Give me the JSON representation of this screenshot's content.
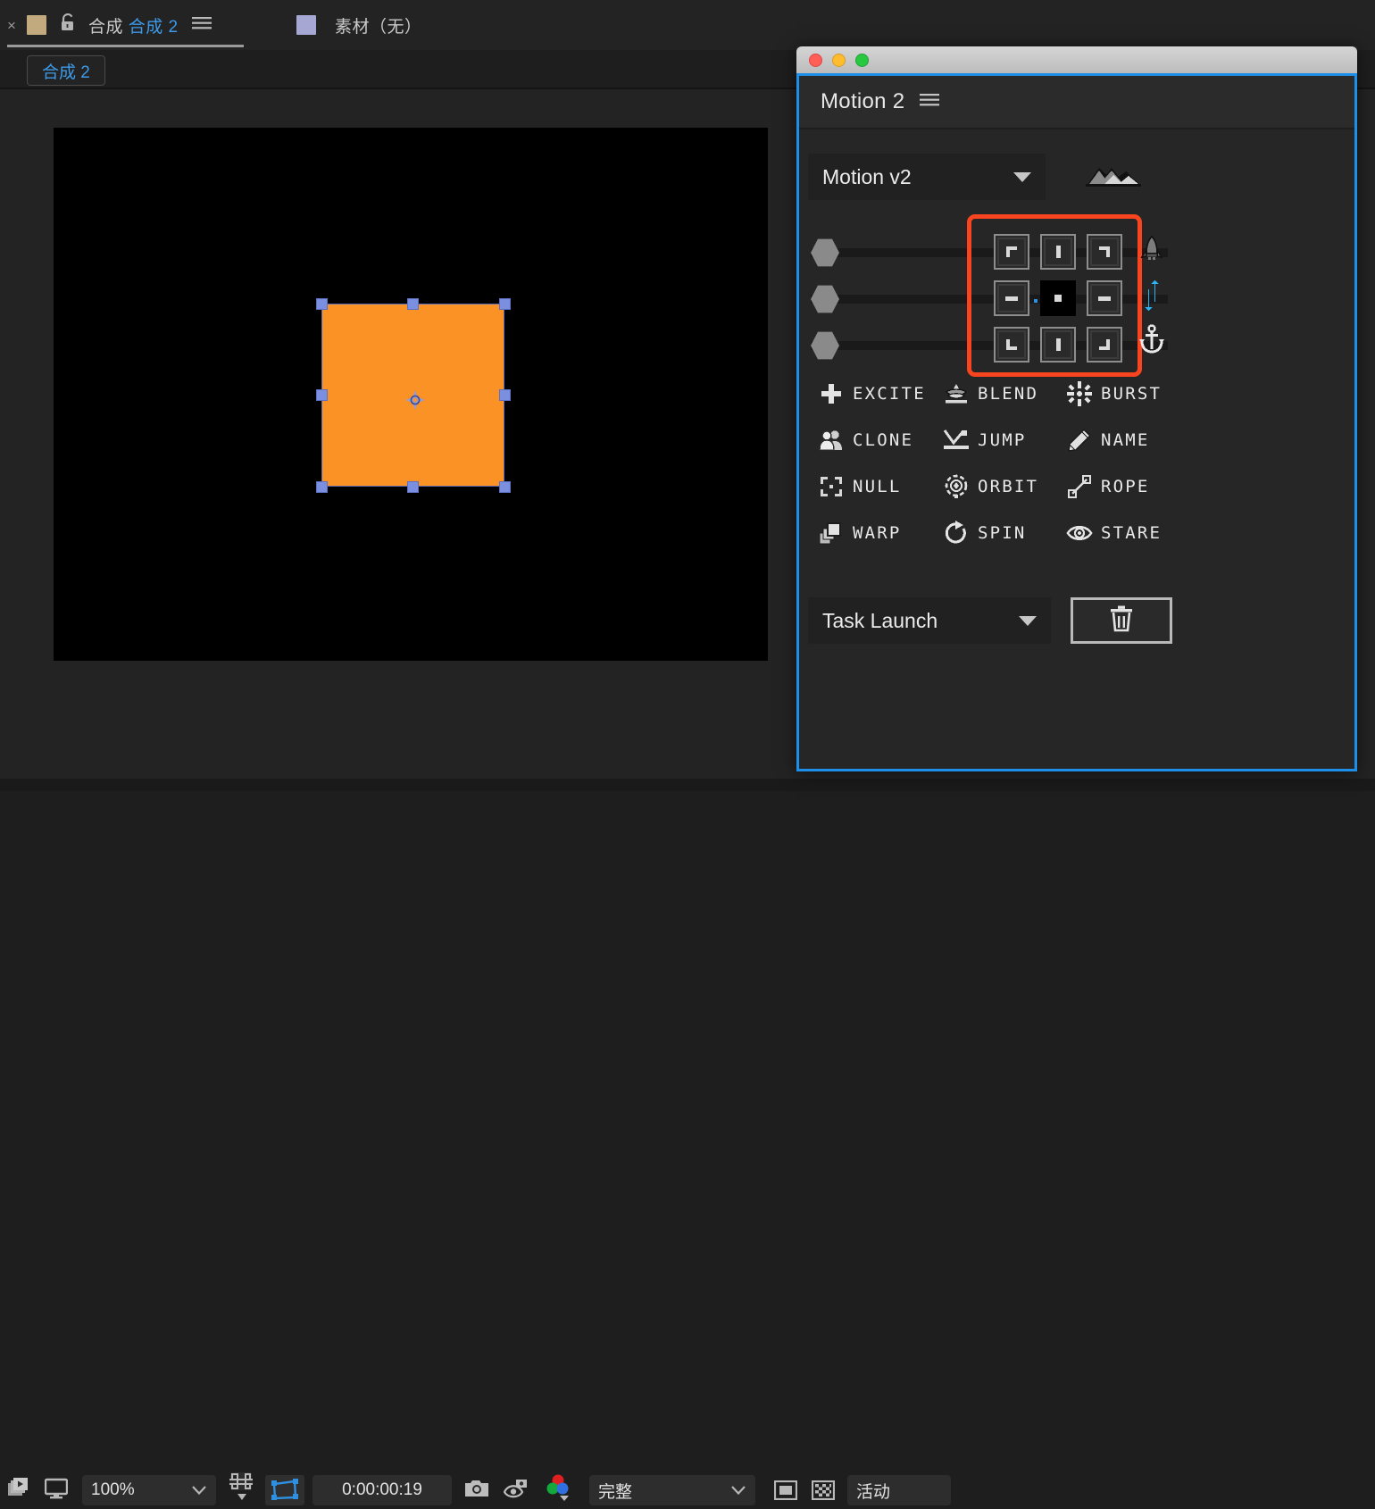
{
  "app": {
    "tabs": [
      {
        "close_label": "×",
        "swatch": "composition-swatch",
        "lock": "lock-icon",
        "label_prefix": "合成",
        "label_highlight": "合成 2",
        "menu": "panel-menu-icon"
      },
      {
        "swatch": "footage-swatch",
        "label": "素材（无）"
      }
    ],
    "comp_chip": "合成 2",
    "bottom_bar": {
      "zoom": "100%",
      "timecode": "0:00:00:19",
      "quality": "完整",
      "region_label": "活动",
      "icons": [
        "take-snapshot-stack-icon",
        "monitor-icon",
        "zoom-dropdown-caret",
        "grid-guides-icon",
        "region-of-interest-icon",
        "snapshot-camera-icon",
        "show-snapshot-icon",
        "channel-rgb-icon",
        "quality-dropdown-caret",
        "transparency-grid-icon",
        "toggle-alpha-icon"
      ]
    }
  },
  "motion_panel": {
    "window_controls": [
      "close-lamp",
      "minimize-lamp",
      "zoom-lamp"
    ],
    "title": "Motion 2",
    "menu_icon": "panel-menu-icon",
    "preset": {
      "value": "Motion v2",
      "caret": "chevron-down-icon",
      "decoration": "mountains-icon"
    },
    "sliders": [
      {
        "name": "slider-1",
        "value": 0
      },
      {
        "name": "slider-2",
        "value": 0
      },
      {
        "name": "slider-3",
        "value": 0
      }
    ],
    "anchor_grid": {
      "highlight_color": "#f9451f",
      "cells": [
        {
          "name": "anchor-top-left",
          "glyph": "corner-top-left",
          "selected": false
        },
        {
          "name": "anchor-top-center",
          "glyph": "bar-vertical",
          "selected": false
        },
        {
          "name": "anchor-top-right",
          "glyph": "corner-top-right",
          "selected": false
        },
        {
          "name": "anchor-middle-left",
          "glyph": "bar-horizontal",
          "selected": false
        },
        {
          "name": "anchor-center",
          "glyph": "dot-square",
          "selected": true
        },
        {
          "name": "anchor-middle-right",
          "glyph": "bar-horizontal",
          "selected": false
        },
        {
          "name": "anchor-bottom-left",
          "glyph": "corner-bottom-left",
          "selected": false
        },
        {
          "name": "anchor-bottom-center",
          "glyph": "bar-vertical",
          "selected": false
        },
        {
          "name": "anchor-bottom-right",
          "glyph": "corner-bottom-right",
          "selected": false
        }
      ]
    },
    "side_icons": [
      "rocket-icon",
      "vertical-arrows-icon",
      "anchor-icon"
    ],
    "tools": [
      {
        "label": "EXCITE",
        "icon": "plus-icon"
      },
      {
        "label": "BLEND",
        "icon": "blend-icon"
      },
      {
        "label": "BURST",
        "icon": "burst-icon"
      },
      {
        "label": "CLONE",
        "icon": "clone-icon"
      },
      {
        "label": "JUMP",
        "icon": "jump-icon"
      },
      {
        "label": "NAME",
        "icon": "pencil-icon"
      },
      {
        "label": "NULL",
        "icon": "null-icon"
      },
      {
        "label": "ORBIT",
        "icon": "orbit-icon"
      },
      {
        "label": "ROPE",
        "icon": "rope-icon"
      },
      {
        "label": "WARP",
        "icon": "warp-icon"
      },
      {
        "label": "SPIN",
        "icon": "spin-icon"
      },
      {
        "label": "STARE",
        "icon": "eye-icon"
      }
    ],
    "task": {
      "value": "Task Launch",
      "caret": "chevron-down-icon",
      "delete_icon": "trash-icon"
    }
  },
  "viewport": {
    "layer_color": "#fb9226",
    "selection_color": "#7a8fe0",
    "anchor_point": "anchor-point-icon"
  }
}
